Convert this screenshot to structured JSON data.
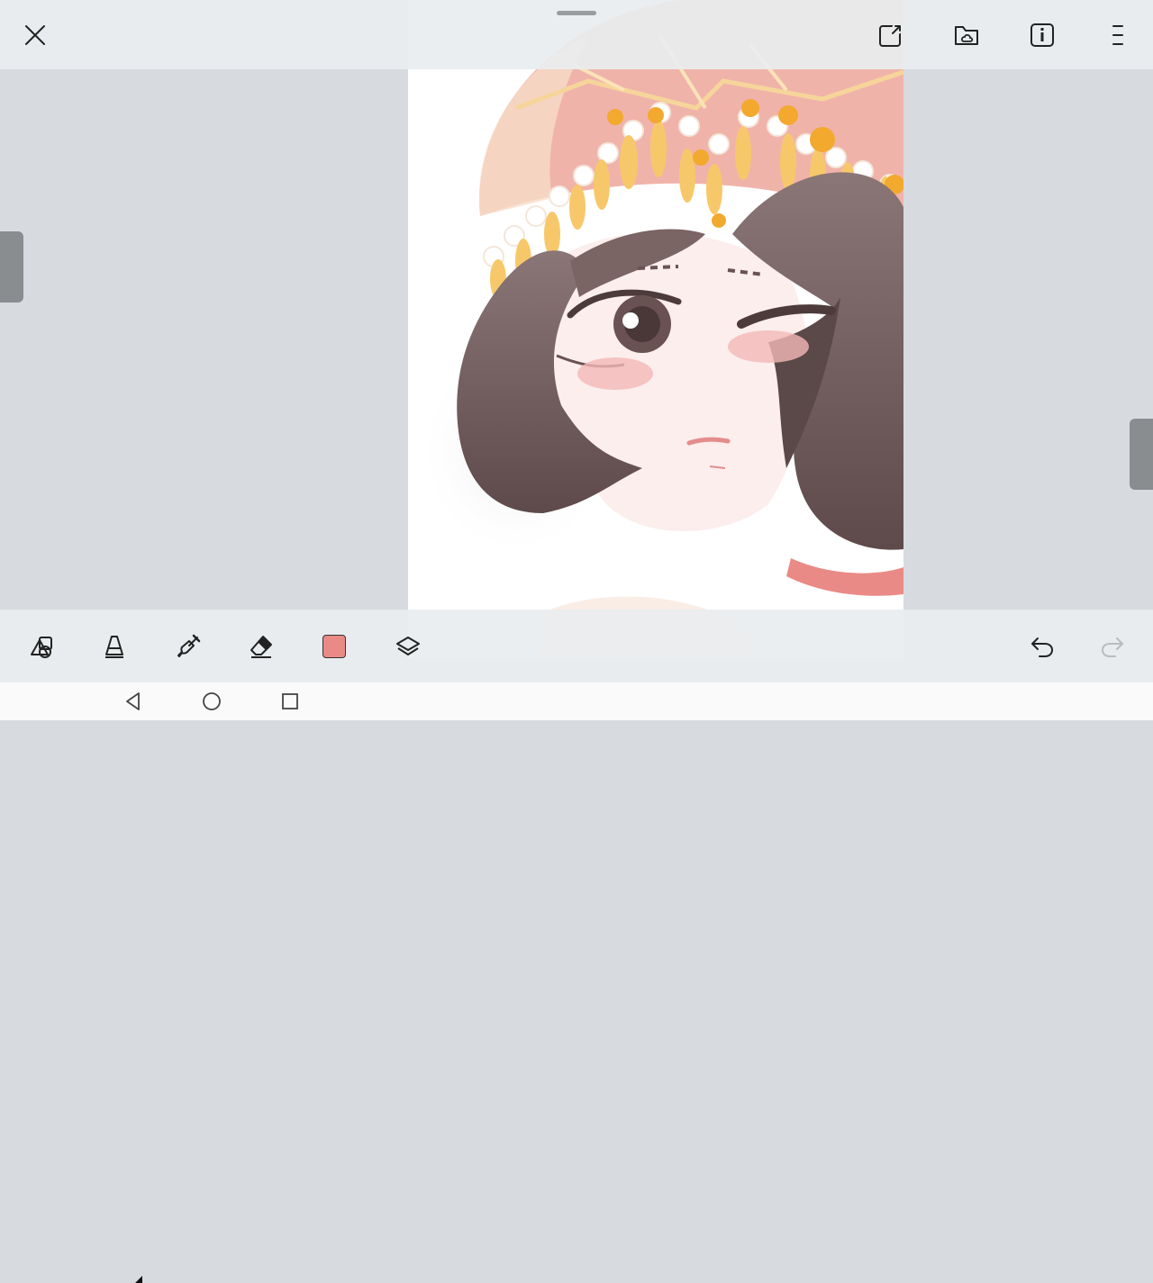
{
  "app": {
    "accent_color": "#ea8a86"
  },
  "topbar": {
    "close_icon": "close-icon",
    "actions": [
      "export-icon",
      "folder-cloud-icon",
      "info-icon",
      "menu-icon"
    ]
  },
  "toolbar": {
    "tools": [
      "shapes-icon",
      "pen-icon",
      "brush-icon",
      "eraser-icon",
      "color-swatch",
      "layers-icon"
    ],
    "current_color": "#ea8a86",
    "undo_icon": "undo-icon",
    "redo_icon": "redo-icon",
    "redo_enabled": false
  },
  "navbar": {
    "buttons": [
      "back-icon",
      "home-icon",
      "recents-icon"
    ]
  }
}
